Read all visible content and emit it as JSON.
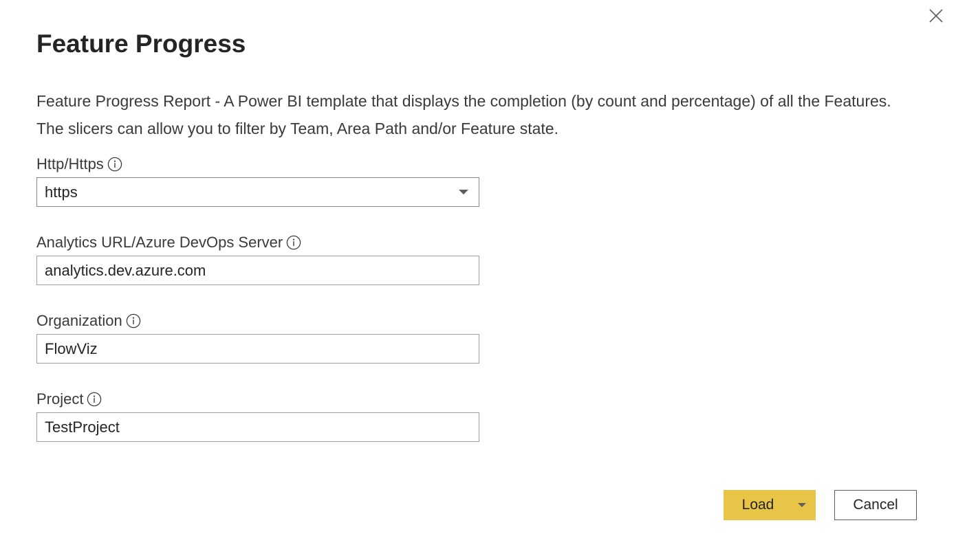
{
  "dialog": {
    "title": "Feature Progress",
    "description": "Feature Progress Report - A Power BI template that displays the completion (by count and percentage) of all the Features. The slicers can allow you to filter by Team, Area Path and/or Feature state."
  },
  "fields": {
    "protocol": {
      "label": "Http/Https",
      "value": "https",
      "icon": "info-icon"
    },
    "analytics_url": {
      "label": "Analytics URL/Azure DevOps Server",
      "value": "analytics.dev.azure.com",
      "icon": "info-icon"
    },
    "organization": {
      "label": "Organization",
      "value": "FlowViz",
      "icon": "info-icon"
    },
    "project": {
      "label": "Project",
      "value": "TestProject",
      "icon": "info-icon"
    }
  },
  "buttons": {
    "load_label": "Load",
    "cancel_label": "Cancel"
  },
  "colors": {
    "accent": "#e8c547",
    "text": "#252423",
    "border": "#a19f9d"
  }
}
